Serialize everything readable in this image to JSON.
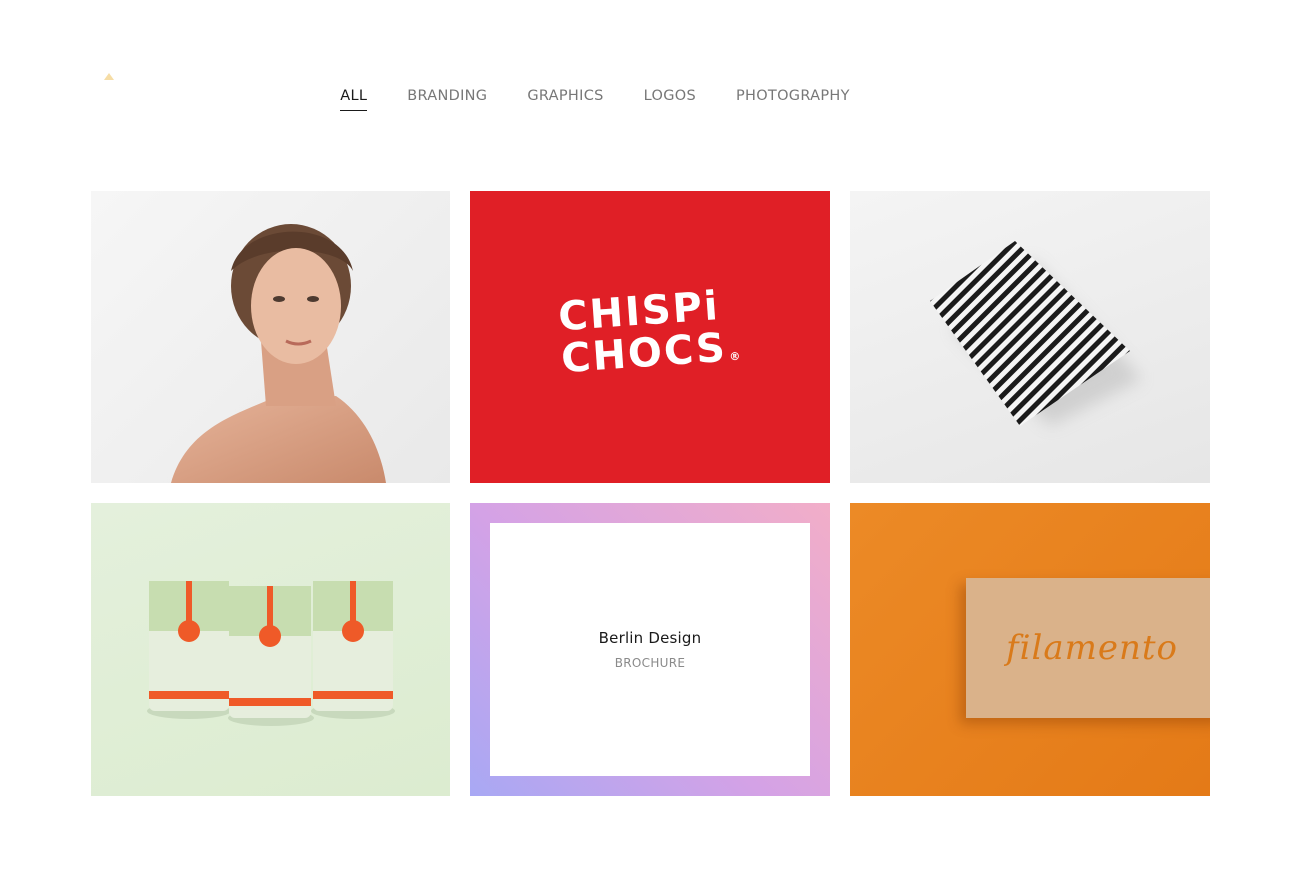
{
  "filters": [
    {
      "label": "ALL",
      "active": true
    },
    {
      "label": "BRANDING",
      "active": false
    },
    {
      "label": "GRAPHICS",
      "active": false
    },
    {
      "label": "LOGOS",
      "active": false
    },
    {
      "label": "PHOTOGRAPHY",
      "active": false
    }
  ],
  "portfolio": {
    "items": [
      {
        "kind": "photo",
        "icon": "portrait-photo"
      },
      {
        "kind": "logo",
        "logo_line1": "CHISPi",
        "logo_line2": "CHOCS",
        "registered": "®"
      },
      {
        "kind": "photo",
        "icon": "pattern-paper-photo"
      },
      {
        "kind": "photo",
        "icon": "product-cans-photo"
      },
      {
        "kind": "hover",
        "title": "Berlin Design",
        "category": "BROCHURE"
      },
      {
        "kind": "photo",
        "card_text": "filamento"
      }
    ]
  },
  "colors": {
    "logo_red": "#e01f26",
    "orange": "#e47a17",
    "accent_triangle": "#f6dda6"
  }
}
